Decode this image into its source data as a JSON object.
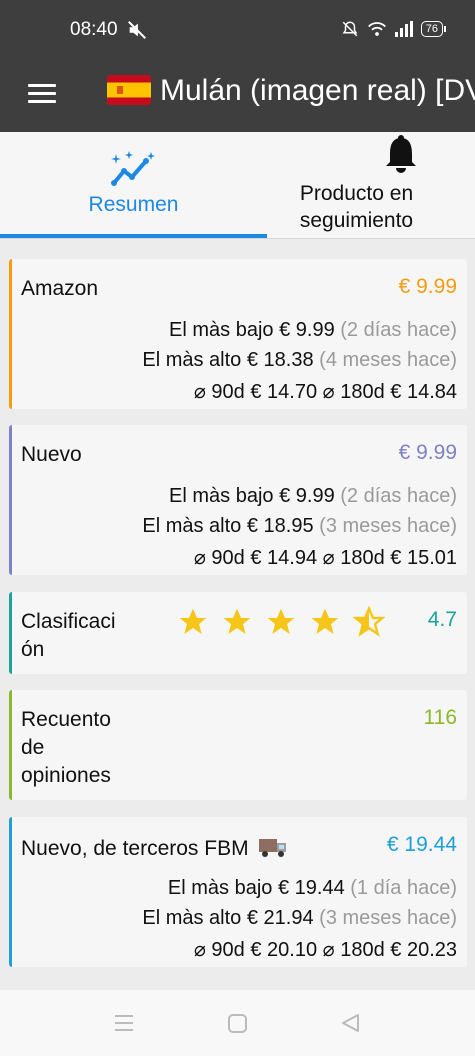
{
  "status_bar": {
    "time": "08:40",
    "battery": "76"
  },
  "app_bar": {
    "title": "Mulán (imagen real) [DVD]"
  },
  "tabs": [
    {
      "label": "Resumen",
      "active": true
    },
    {
      "label_line1": "Producto en",
      "label_line2": "seguimiento",
      "active": false
    }
  ],
  "colors": {
    "accent": "#1e88e5",
    "amazon": "#f39c12",
    "nuevo": "#7e81c4",
    "rating": "#1ba39c",
    "reviews": "#8bb82c",
    "fbm": "#1e9fd6",
    "star": "#f5c518"
  },
  "cards": {
    "amazon": {
      "title": "Amazon",
      "price": "€ 9.99",
      "low_label": "El màs bajo",
      "low_price": "€ 9.99",
      "low_when": "(2 días hace)",
      "high_label": "El màs alto",
      "high_price": "€ 18.38",
      "high_when": "(4 meses hace)",
      "avg": "⌀ 90d € 14.70 ⌀ 180d € 14.84"
    },
    "nuevo": {
      "title": "Nuevo",
      "price": "€ 9.99",
      "low_label": "El màs bajo",
      "low_price": "€ 9.99",
      "low_when": "(2 días hace)",
      "high_label": "El màs alto",
      "high_price": "€ 18.95",
      "high_when": "(3 meses hace)",
      "avg": "⌀ 90d € 14.94 ⌀ 180d € 15.01"
    },
    "rating": {
      "title_line1": "Clasificaci",
      "title_line2": "ón",
      "stars": 4.5,
      "value": "4.7"
    },
    "reviews": {
      "title_line1": "Recuento",
      "title_line2": "de",
      "title_line3": "opiniones",
      "value": "116"
    },
    "fbm": {
      "title": "Nuevo, de terceros FBM",
      "price": "€ 19.44",
      "low_label": "El màs bajo",
      "low_price": "€ 19.44",
      "low_when": "(1 día hace)",
      "high_label": "El màs alto",
      "high_price": "€ 21.94",
      "high_when": "(3 meses hace)",
      "avg": "⌀ 90d € 20.10 ⌀ 180d € 20.23"
    }
  }
}
